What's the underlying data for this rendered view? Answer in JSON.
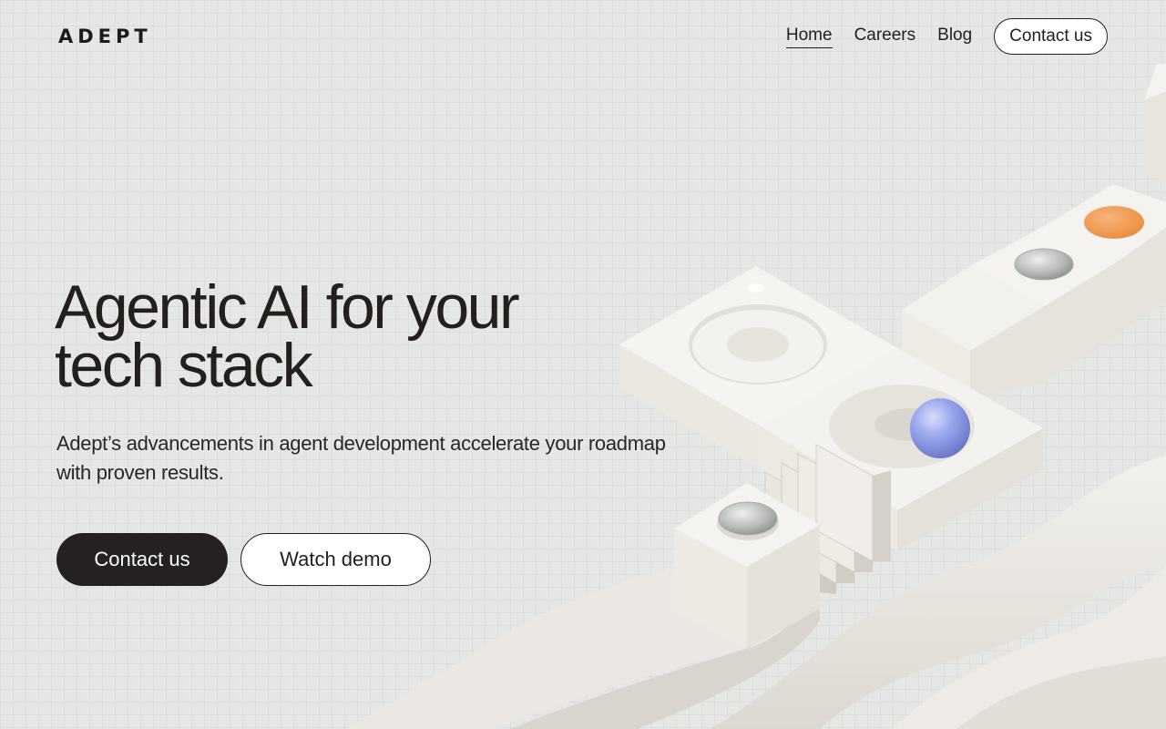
{
  "header": {
    "logo": "ADEPT",
    "nav": {
      "home": "Home",
      "careers": "Careers",
      "blog": "Blog",
      "contact": "Contact us"
    }
  },
  "hero": {
    "title_line1": "Agentic AI for your",
    "title_line2": "tech stack",
    "subtitle": "Adept’s advancements in agent development accelerate your roadmap with proven results.",
    "primary_cta": "Contact us",
    "secondary_cta": "Watch demo"
  },
  "colors": {
    "background": "#e6e6e5",
    "text": "#231f1c",
    "primary_button": "#252120",
    "orange_accent": "#f29a4a",
    "blue_sphere": "#8f9ee8"
  }
}
